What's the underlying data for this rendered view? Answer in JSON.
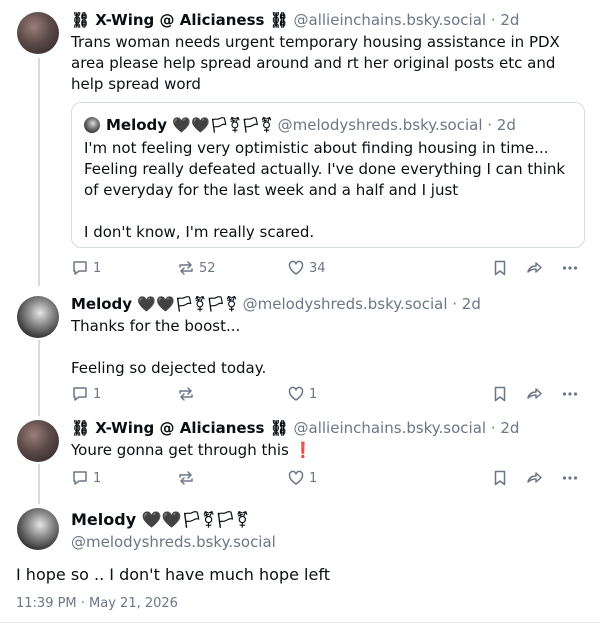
{
  "posts": [
    {
      "author": "⛓ X-Wing @ Alicianess ⛓",
      "handle": "@allieinchains.bsky.social",
      "time": " · 2d",
      "text": "Trans woman needs urgent temporary housing assistance in PDX area please help spread around and rt her original posts etc and help spread word",
      "quote": {
        "author": "Melody 🖤🖤🏳⚧🏳⚧",
        "handle": "@melodyshreds.bsky.social",
        "time": " · 2d",
        "text": "I'm not feeling very optimistic about finding housing in time... Feeling really defeated actually. I've done everything I can think of everyday for the last week and a half and I just\n\nI don't know, I'm really scared."
      },
      "replies": "1",
      "reposts": "52",
      "likes": "34"
    },
    {
      "author": "Melody 🖤🖤🏳⚧🏳⚧",
      "handle": "@melodyshreds.bsky.social",
      "time": " · 2d",
      "text": "Thanks for the boost...\n\nFeeling so dejected today.",
      "replies": "1",
      "reposts": "",
      "likes": "1"
    },
    {
      "author": "⛓ X-Wing @ Alicianess ⛓",
      "handle": "@allieinchains.bsky.social",
      "time": " · 2d",
      "text": "Youre gonna get through this ❗",
      "replies": "1",
      "reposts": "",
      "likes": "1"
    }
  ],
  "main": {
    "author": "Melody 🖤🖤🏳⚧🏳⚧",
    "handle": "@melodyshreds.bsky.social",
    "text": "I hope so .. I don't have much hope left",
    "timestamp": "11:39 PM · May 21, 2026"
  },
  "icons": [
    "reply-icon",
    "repost-icon",
    "like-icon",
    "bookmark-icon",
    "share-icon",
    "more-icon"
  ]
}
